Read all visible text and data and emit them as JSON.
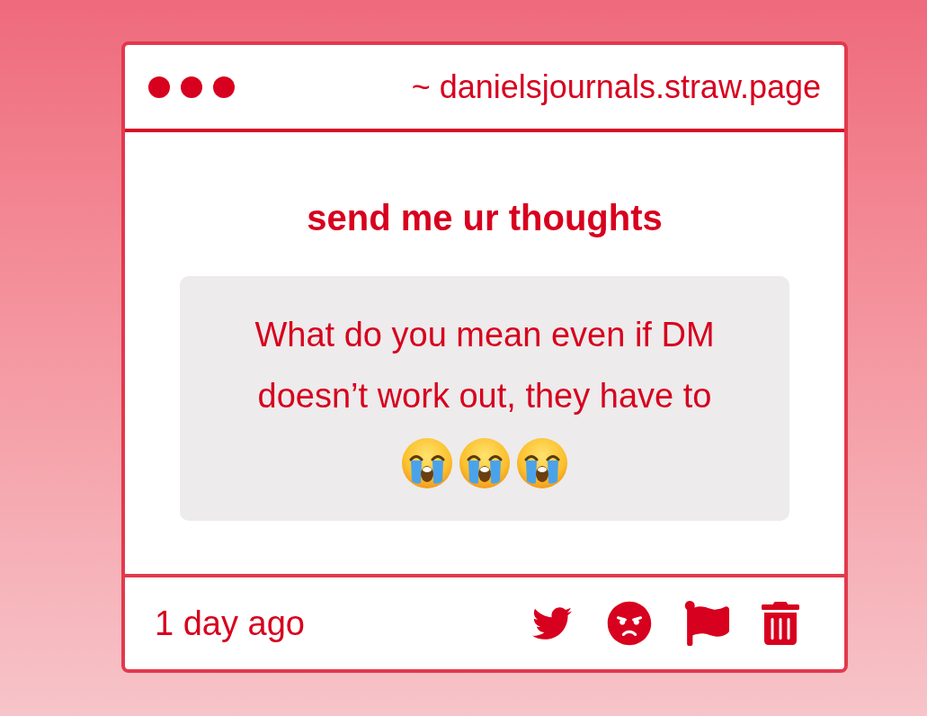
{
  "window": {
    "url": "~ danielsjournals.straw.page"
  },
  "prompt": {
    "title": "send me ur thoughts"
  },
  "message": {
    "text": "What do you mean even if DM doesn’t work out, they have to",
    "emojis": [
      {
        "kind": "loudly-crying"
      },
      {
        "kind": "loudly-crying"
      },
      {
        "kind": "loudly-crying"
      }
    ]
  },
  "footer": {
    "time": "1 day ago",
    "actions": [
      {
        "kind": "tweet"
      },
      {
        "kind": "angry"
      },
      {
        "kind": "report"
      },
      {
        "kind": "delete"
      }
    ]
  }
}
